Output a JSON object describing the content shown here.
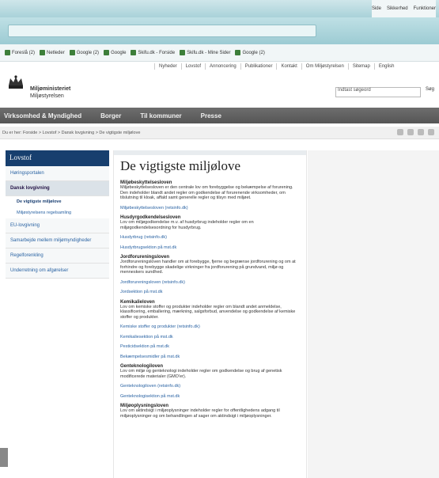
{
  "browser": {
    "favorites": [
      "Foreslå (2)",
      "Netleder",
      "Google (2)",
      "Google",
      "Skifu.dk - Forside",
      "Skifu.dk - Mine Sider",
      "Google (2)"
    ],
    "tools": [
      "Side",
      "Sikkerhed",
      "Funktioner"
    ]
  },
  "header": {
    "top_nav": [
      "Nyheder",
      "Lovstof",
      "Annoncering",
      "Publikationer",
      "Kontakt",
      "Om Miljøstyrelsen",
      "Sitemap",
      "English"
    ],
    "org_name": "Miljøministeriet",
    "org_sub": "Miljøstyrelsen",
    "search_placeholder": "Indtast søgeord",
    "search_button": "Søg",
    "main_nav": [
      "Virksomhed & Myndighed",
      "Borger",
      "Til kommuner",
      "Presse"
    ],
    "breadcrumb": "Du er her: Forside > Lovstof > Dansk lovgivning > De vigtigste miljølove"
  },
  "sidebar": {
    "heading": "Lovstof",
    "items": [
      {
        "label": "Høringsportalen",
        "type": "item"
      },
      {
        "label": "Dansk lovgivning",
        "type": "selected"
      },
      {
        "label": "De vigtigste miljølove",
        "type": "current"
      },
      {
        "label": "Miljøstyrelsens regelsamling",
        "type": "sub"
      },
      {
        "label": "EU-lovgivning",
        "type": "item"
      },
      {
        "label": "Samarbejde mellem miljømyndigheder",
        "type": "item"
      },
      {
        "label": "Regelforenkling",
        "type": "item"
      },
      {
        "label": "Underretning om afgørelser",
        "type": "item"
      }
    ]
  },
  "main": {
    "title": "De vigtigste miljølove",
    "sections": [
      {
        "heading": "Miljøbeskyttelsesloven",
        "text": "Miljøbeskyttelsesloven er den centrale lov om forebyggelse og bekæmpelse af forurening. Den indeholder blandt andet regler om godkendelse af forurenende virksomheder, om tilslutning til kloak, affald samt generelle regler og tilsyn med miljøet.",
        "links": [
          "Miljøbeskyttelsesloven (retsinfo.dk)"
        ]
      },
      {
        "heading": "Husdyrgodkendelsesloven",
        "text": "Lov om miljøgodkendelse m.v. af husdyrbrug indeholder regler om en miljøgodkendelsesordning for husdyrbrug.",
        "links": [
          "Husdyrbrug (retsinfo.dk)",
          "Husdyrbrugsektion på mst.dk"
        ]
      },
      {
        "heading": "Jordforureningsloven",
        "text": "Jordforureningsloven handler om at forebygge, fjerne og begrænse jordforurening og om at forhindre og forebygge skadelige virkninger fra jordforurening på grundvand, miljø og menneskers sundhed.",
        "links": [
          "Jordforureningsloven (retsinfo.dk)",
          "Jordsektion på mst.dk"
        ]
      },
      {
        "heading": "Kemikalieloven",
        "text": "Lov om kemiske stoffer og produkter indeholder regler om blandt andet anmeldelse, klassificering, emballering, mærkning, salgsforbud, anvendelse og godkendelse af kemiske stoffer og produkter.",
        "links": [
          "Kemiske stoffer og produkter (retsinfo.dk)",
          "Kemikaliesektion på mst.dk",
          "Pesticidsektion på mst.dk",
          "Bekæmpelsesmidler på mst.dk"
        ]
      },
      {
        "heading": "Genteknologiloven",
        "text": "Lov om miljø og genteknologi indeholder regler om godkendelse og brug af genetisk modificerede materialer (GMO'er).",
        "links": [
          "Genteknologiloven (retsinfo.dk)",
          "Genteknologisektion på mst.dk"
        ]
      },
      {
        "heading": "Miljøoplysningsloven",
        "text": "Lov om aktindsigt i miljøoplysninger indeholder regler for offentlighedens adgang til miljøoplysninger og om behandlingen af sager om aktindsigt i miljøoplysninger.",
        "links": []
      }
    ]
  }
}
